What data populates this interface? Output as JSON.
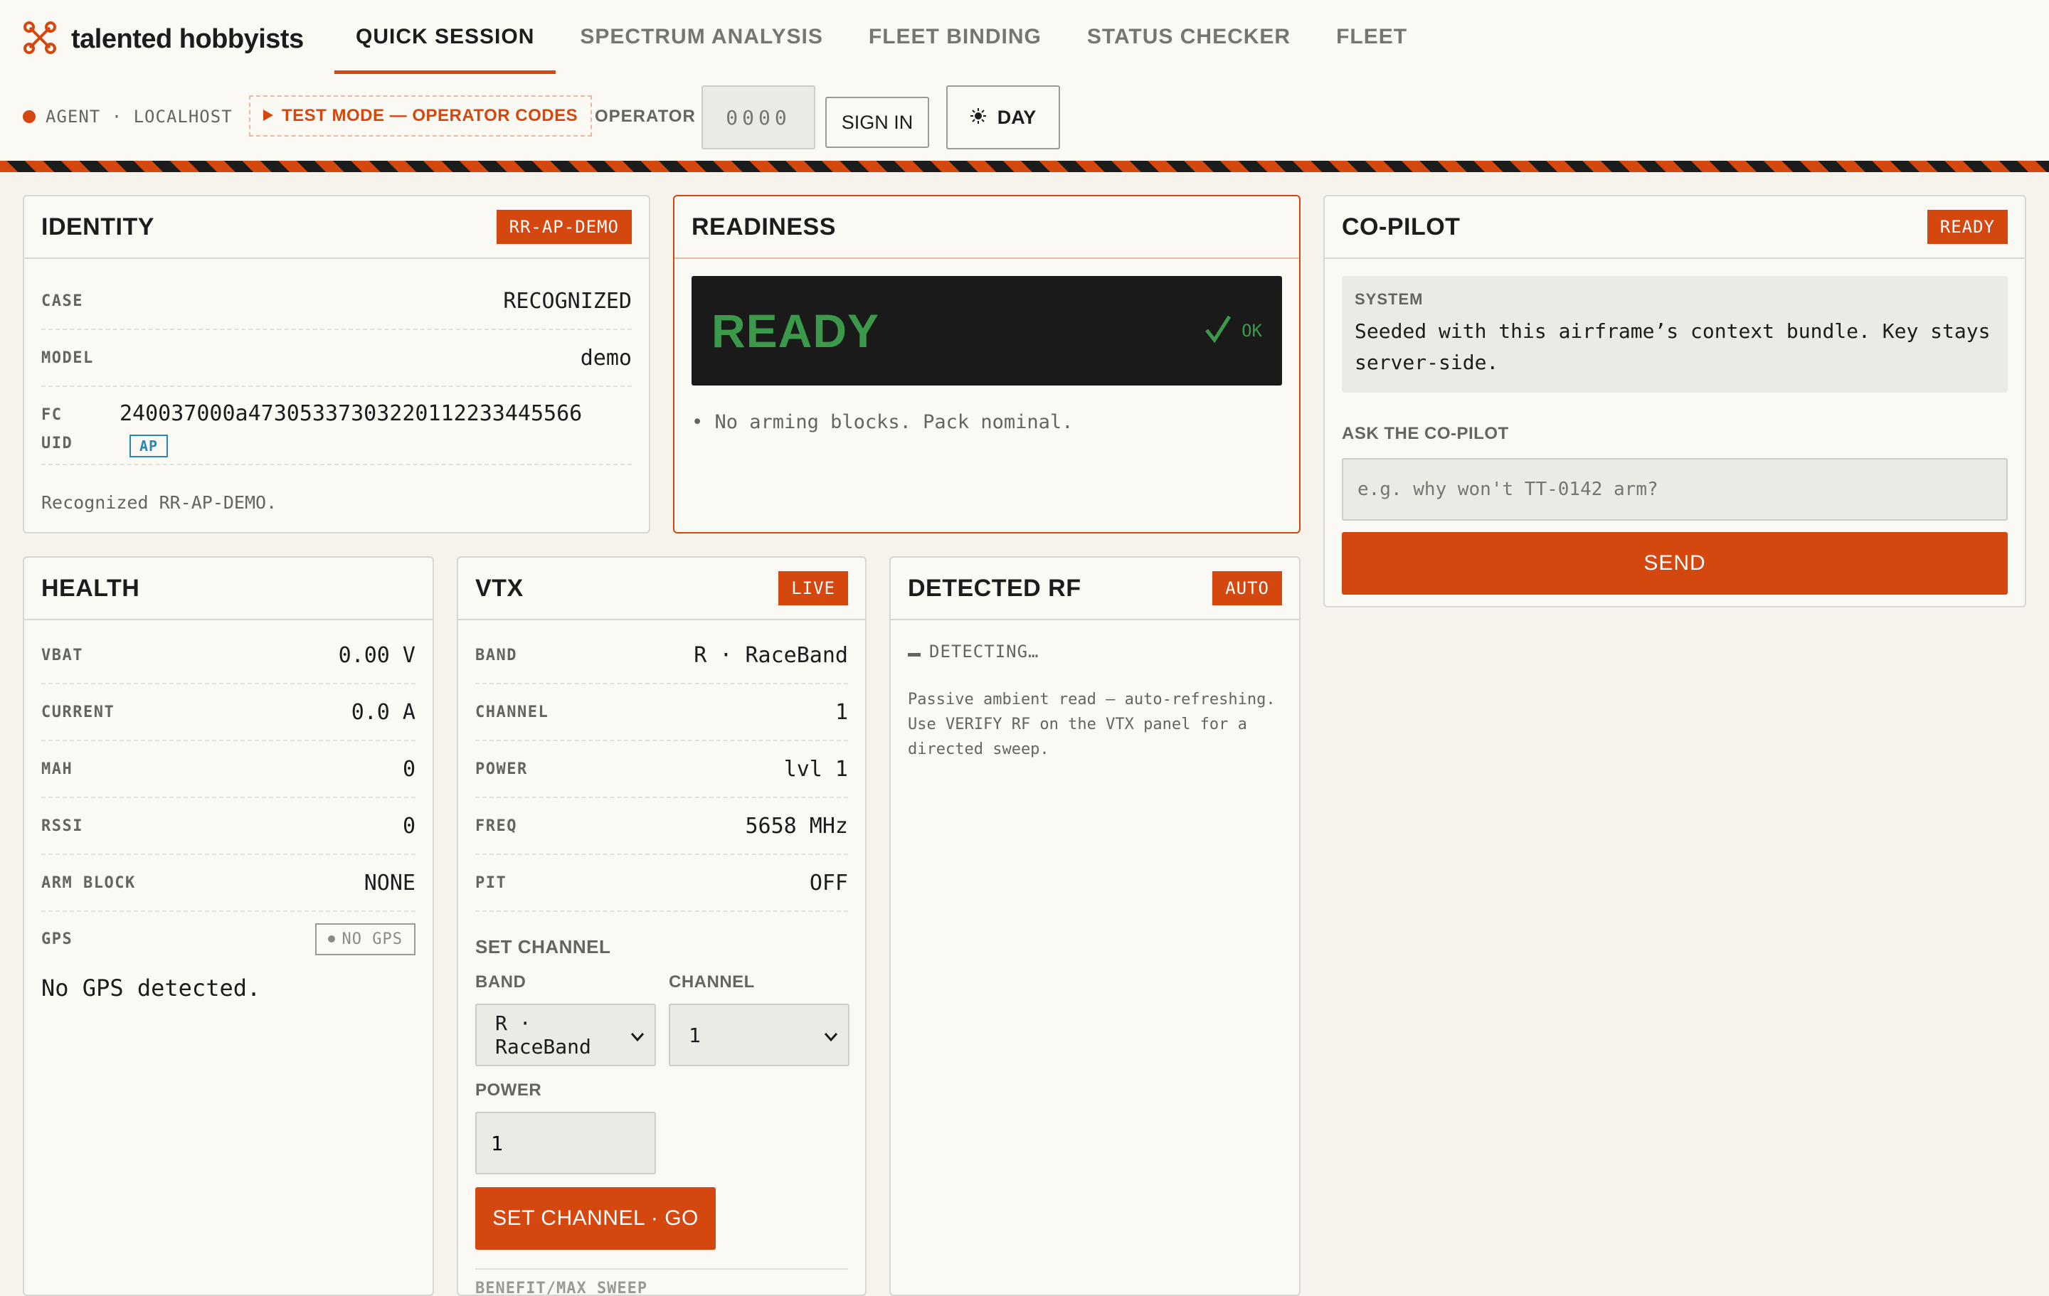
{
  "brand": {
    "name": "talented hobbyists"
  },
  "nav": {
    "tabs": [
      {
        "label": "QUICK SESSION"
      },
      {
        "label": "SPECTRUM ANALYSIS"
      },
      {
        "label": "FLEET BINDING"
      },
      {
        "label": "STATUS CHECKER"
      },
      {
        "label": "FLEET"
      }
    ],
    "active_tab": "QUICK SESSION"
  },
  "status": {
    "agent": "AGENT · LOCALHOST",
    "test_mode": "TEST MODE — OPERATOR CODES",
    "operator_label": "OPERATOR",
    "operator_placeholder": "0000",
    "sign_in": "SIGN IN",
    "theme": "DAY"
  },
  "identity": {
    "title": "IDENTITY",
    "badge": "RR-AP-DEMO",
    "rows": [
      {
        "key": "CASE",
        "value": "RECOGNIZED"
      },
      {
        "key": "MODEL",
        "value": "demo"
      }
    ],
    "fc_uid_key_1": "FC",
    "fc_uid_key_2": "UID",
    "fc_uid": "240037000a47305337303220112233445566",
    "fc_tag": "AP",
    "note": "Recognized RR-AP-DEMO."
  },
  "readiness": {
    "title": "READINESS",
    "state": "READY",
    "ok": "OK",
    "bullet": "No arming blocks. Pack nominal."
  },
  "copilot": {
    "title": "CO-PILOT",
    "badge": "READY",
    "system_label": "SYSTEM",
    "system_text": "Seeded with this airframe’s context bundle. Key stays server-side.",
    "ask_label": "ASK THE CO-PILOT",
    "ask_placeholder": "e.g. why won't TT-0142 arm?",
    "send": "SEND"
  },
  "health": {
    "title": "HEALTH",
    "rows": [
      {
        "key": "VBAT",
        "value": "0.00 V"
      },
      {
        "key": "CURRENT",
        "value": "0.0 A"
      },
      {
        "key": "MAH",
        "value": "0"
      },
      {
        "key": "RSSI",
        "value": "0"
      },
      {
        "key": "ARM BLOCK",
        "value": "NONE"
      }
    ],
    "gps_key": "GPS",
    "gps_badge": "NO GPS",
    "gps_msg": "No GPS detected."
  },
  "vtx": {
    "title": "VTX",
    "badge": "LIVE",
    "rows": [
      {
        "key": "BAND",
        "value": "R · RaceBand"
      },
      {
        "key": "CHANNEL",
        "value": "1"
      },
      {
        "key": "POWER",
        "value": "lvl 1"
      },
      {
        "key": "FREQ",
        "value": "5658 MHz"
      },
      {
        "key": "PIT",
        "value": "OFF"
      }
    ],
    "set_channel_label": "SET CHANNEL",
    "band_label": "BAND",
    "band_value": "R · RaceBand",
    "channel_label": "CHANNEL",
    "channel_value": "1",
    "power_label": "POWER",
    "power_value": "1",
    "go": "SET CHANNEL · GO",
    "cut_label": "BENEFIT/MAX SWEEP"
  },
  "rf": {
    "title": "DETECTED RF",
    "badge": "AUTO",
    "status": "DETECTING…",
    "note": "Passive ambient read — auto-refreshing. Use VERIFY RF on the VTX panel for a directed sweep."
  },
  "colors": {
    "accent": "#d4470f",
    "ok": "#3a9a4a",
    "info": "#2a86b6"
  }
}
